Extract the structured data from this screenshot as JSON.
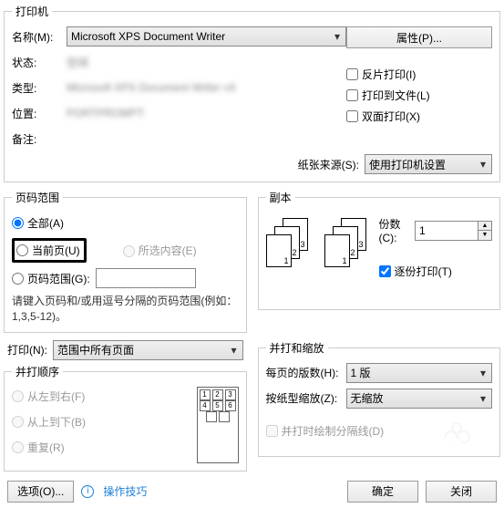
{
  "printer": {
    "legend": "打印机",
    "name_label": "名称(M):",
    "name_value": "Microsoft XPS Document Writer",
    "properties_btn": "属性(P)...",
    "status_label": "状态:",
    "status_value": "空闲",
    "type_label": "类型:",
    "type_value": "Microsoft XPS Document Writer v4",
    "location_label": "位置:",
    "location_value": "PORTPROMPT:",
    "comment_label": "备注:",
    "reverse_print": "反片打印(I)",
    "print_to_file": "打印到文件(L)",
    "duplex": "双面打印(X)",
    "paper_source_label": "纸张来源(S):",
    "paper_source_value": "使用打印机设置"
  },
  "range": {
    "legend": "页码范围",
    "all": "全部(A)",
    "current": "当前页(U)",
    "selection": "所选内容(E)",
    "pages": "页码范围(G):",
    "hint": "请键入页码和/或用逗号分隔的页码范围(例如：1,3,5-12)。",
    "print_label": "打印(N):",
    "print_value": "范围中所有页面"
  },
  "copies": {
    "legend": "副本",
    "count_label": "份数(C):",
    "count_value": "1",
    "collate": "逐份打印(T)"
  },
  "scale": {
    "legend": "并打和缩放",
    "per_sheet_label": "每页的版数(H):",
    "per_sheet_value": "1 版",
    "scale_label": "按纸型缩放(Z):",
    "scale_value": "无缩放",
    "draw_lines": "并打时绘制分隔线(D)"
  },
  "order": {
    "legend": "并打顺序",
    "lr": "从左到右(F)",
    "tb": "从上到下(B)",
    "repeat": "重复(R)"
  },
  "footer": {
    "options": "选项(O)...",
    "tip": "操作技巧",
    "ok": "确定",
    "close": "关闭"
  }
}
